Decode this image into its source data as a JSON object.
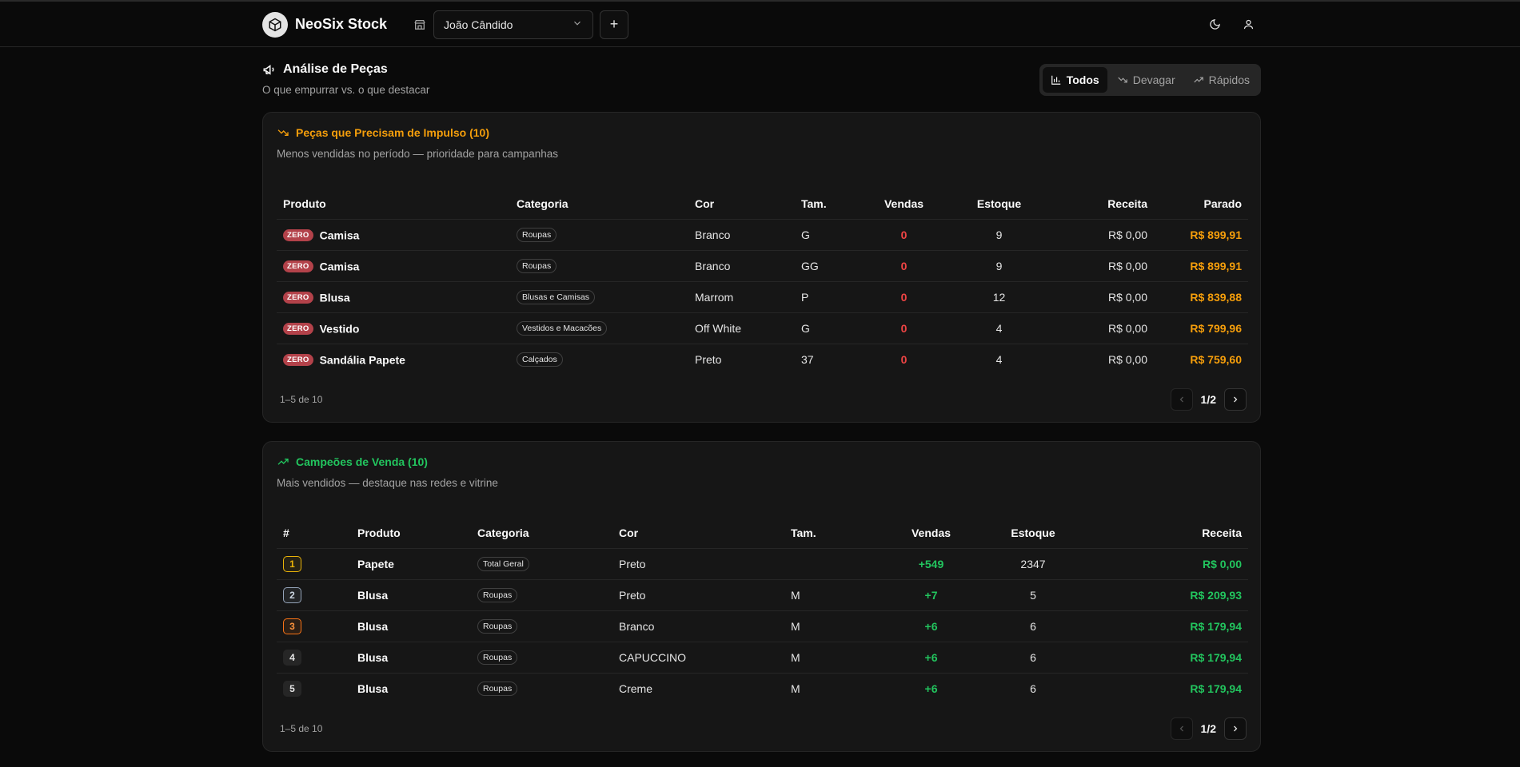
{
  "header": {
    "brand": "NeoSix Stock",
    "store": "João Cândido",
    "add_label": "+"
  },
  "page": {
    "title": "Análise de Peças",
    "subtitle": "O que empurrar vs. o que destacar",
    "filters": [
      {
        "label": "Todos",
        "active": true
      },
      {
        "label": "Devagar",
        "active": false
      },
      {
        "label": "Rápidos",
        "active": false
      }
    ]
  },
  "slow": {
    "title": "Peças que Precisam de Impulso (10)",
    "description": "Menos vendidas no período — prioridade para campanhas",
    "accent": "#f59e0b",
    "columns": [
      "Produto",
      "Categoria",
      "Cor",
      "Tam.",
      "Vendas",
      "Estoque",
      "Receita",
      "Parado"
    ],
    "badge": "ZERO",
    "rows": [
      {
        "produto": "Camisa",
        "categoria": "Roupas",
        "cor": "Branco",
        "tam": "G",
        "vendas": "0",
        "estoque": "9",
        "receita": "R$ 0,00",
        "parado": "R$ 899,91"
      },
      {
        "produto": "Camisa",
        "categoria": "Roupas",
        "cor": "Branco",
        "tam": "GG",
        "vendas": "0",
        "estoque": "9",
        "receita": "R$ 0,00",
        "parado": "R$ 899,91"
      },
      {
        "produto": "Blusa",
        "categoria": "Blusas e Camisas",
        "cor": "Marrom",
        "tam": "P",
        "vendas": "0",
        "estoque": "12",
        "receita": "R$ 0,00",
        "parado": "R$ 839,88"
      },
      {
        "produto": "Vestido",
        "categoria": "Vestidos e Macacões",
        "cor": "Off White",
        "tam": "G",
        "vendas": "0",
        "estoque": "4",
        "receita": "R$ 0,00",
        "parado": "R$ 799,96"
      },
      {
        "produto": "Sandália Papete",
        "categoria": "Calçados",
        "cor": "Preto",
        "tam": "37",
        "vendas": "0",
        "estoque": "4",
        "receita": "R$ 0,00",
        "parado": "R$ 759,60"
      }
    ],
    "range": "1–5 de 10",
    "page": "1/2"
  },
  "top": {
    "title": "Campeões de Venda (10)",
    "description": "Mais vendidos — destaque nas redes e vitrine",
    "accent": "#22c55e",
    "columns": [
      "#",
      "Produto",
      "Categoria",
      "Cor",
      "Tam.",
      "Vendas",
      "Estoque",
      "Receita"
    ],
    "rows": [
      {
        "rank": "1",
        "produto": "Papete",
        "categoria": "Total Geral",
        "cor": "Preto",
        "tam": "",
        "vendas": "+549",
        "estoque": "2347",
        "receita": "R$ 0,00"
      },
      {
        "rank": "2",
        "produto": "Blusa",
        "categoria": "Roupas",
        "cor": "Preto",
        "tam": "M",
        "vendas": "+7",
        "estoque": "5",
        "receita": "R$ 209,93"
      },
      {
        "rank": "3",
        "produto": "Blusa",
        "categoria": "Roupas",
        "cor": "Branco",
        "tam": "M",
        "vendas": "+6",
        "estoque": "6",
        "receita": "R$ 179,94"
      },
      {
        "rank": "4",
        "produto": "Blusa",
        "categoria": "Roupas",
        "cor": "CAPUCCINO",
        "tam": "M",
        "vendas": "+6",
        "estoque": "6",
        "receita": "R$ 179,94"
      },
      {
        "rank": "5",
        "produto": "Blusa",
        "categoria": "Roupas",
        "cor": "Creme",
        "tam": "M",
        "vendas": "+6",
        "estoque": "6",
        "receita": "R$ 179,94"
      }
    ],
    "range": "1–5 de 10",
    "page": "1/2"
  }
}
